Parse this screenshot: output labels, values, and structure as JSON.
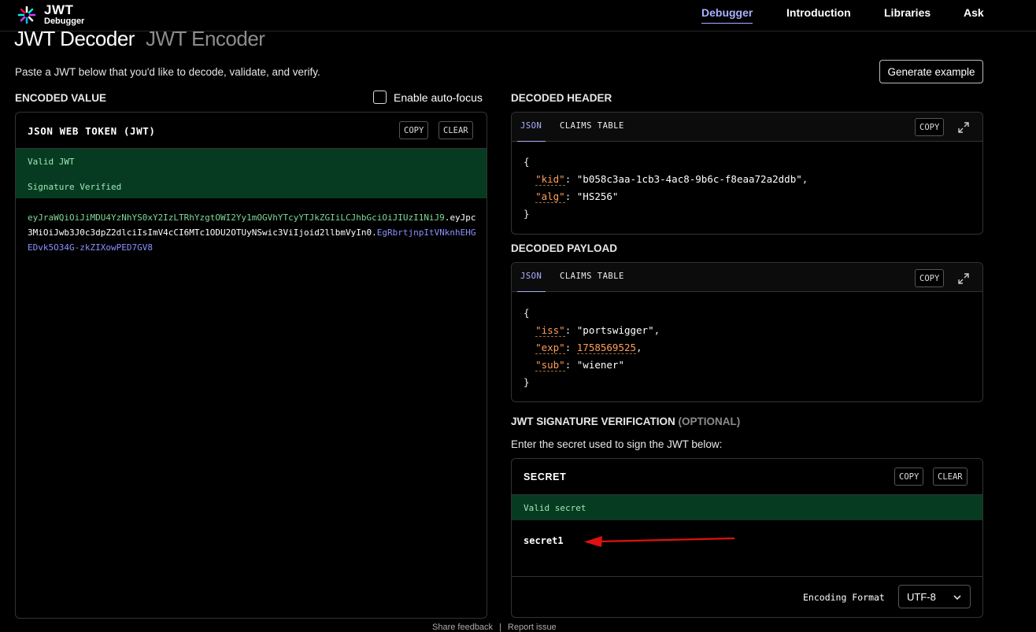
{
  "nav": {
    "logo_title": "JWT",
    "logo_subtitle": "Debugger",
    "items": [
      "Debugger",
      "Introduction",
      "Libraries",
      "Ask"
    ]
  },
  "header": {
    "tab_decoder": "JWT Decoder",
    "tab_encoder": "JWT Encoder",
    "intro": "Paste a JWT below that you'd like to decode, validate, and verify.",
    "generate_label": "Generate example"
  },
  "encoded": {
    "section_label": "ENCODED VALUE",
    "autofocus_label": "Enable auto-focus",
    "autofocus_checked": false,
    "panel_title": "JSON WEB TOKEN (JWT)",
    "copy_label": "COPY",
    "clear_label": "CLEAR",
    "status_valid": "Valid JWT",
    "status_signature": "Signature Verified",
    "token_header": "eyJraWQiOiJiMDU4YzNhYS0xY2IzLTRhYzgtOWI2Yy1mOGVhYTcyYTJkZGIiLCJhbGciOiJIUzI1NiJ9",
    "token_payload": "eyJpc3MiOiJwb3J0c3dpZ2dlciIsImV4cCI6MTc1ODU2OTUyNSwic3ViIjoid2llbmVyIn0",
    "token_signature": "EgRbrtjnpItVNknhEHGEDvk5O34G-zkZIXowPED7GV8",
    "dot": "."
  },
  "decoded_header": {
    "section_label": "DECODED HEADER",
    "tab_json": "JSON",
    "tab_claims": "CLAIMS TABLE",
    "copy_label": "COPY",
    "fields": [
      {
        "key": "\"kid\"",
        "value": "\"b058c3aa-1cb3-4ac8-9b6c-f8eaa72a2ddb\""
      },
      {
        "key": "\"alg\"",
        "value": "\"HS256\""
      }
    ]
  },
  "decoded_payload": {
    "section_label": "DECODED PAYLOAD",
    "tab_json": "JSON",
    "tab_claims": "CLAIMS TABLE",
    "copy_label": "COPY",
    "fields": [
      {
        "key": "\"iss\"",
        "value": "\"portswigger\""
      },
      {
        "key": "\"exp\"",
        "value": "1758569525"
      },
      {
        "key": "\"sub\"",
        "value": "\"wiener\""
      }
    ]
  },
  "signature": {
    "section_label": "JWT SIGNATURE VERIFICATION",
    "section_optional": "(OPTIONAL)",
    "instruction": "Enter the secret used to sign the JWT below:",
    "panel_title": "SECRET",
    "copy_label": "COPY",
    "clear_label": "CLEAR",
    "status_valid": "Valid secret",
    "secret_value": "secret1",
    "encoding_label": "Encoding Format",
    "encoding_value": "UTF-8"
  },
  "footer": {
    "feedback": "Share feedback",
    "separator": "|",
    "report": "Report issue"
  },
  "colors": {
    "accent": "#a9b1ff",
    "valid_bg": "#063b22",
    "json_key": "#ff9f5a",
    "annotation_arrow": "#e01010"
  }
}
